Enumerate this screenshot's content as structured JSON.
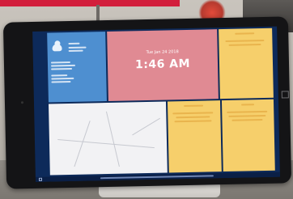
{
  "scene": {
    "wall_color": "#c2bdb6",
    "corner_tag_color": "#d21e3c"
  },
  "tablet": {
    "bezel_color": "#141416",
    "dashboard": {
      "weather": {
        "tile_color": "#4e8fd0",
        "icon": "partly-cloudy-icon"
      },
      "clock": {
        "tile_color": "#e08a93",
        "date": "Tue Jan 24 2018",
        "time": "1:46 AM"
      },
      "notes": {
        "tile_color": "#f6cf6b"
      },
      "map": {
        "tile_color": "#f2f2f4"
      },
      "tile_bottom_middle": {
        "tile_color": "#f6cf6b"
      },
      "tile_bottom_right": {
        "tile_color": "#f6cf6b"
      }
    },
    "taskbar": {
      "color": "#0a1f46"
    }
  }
}
